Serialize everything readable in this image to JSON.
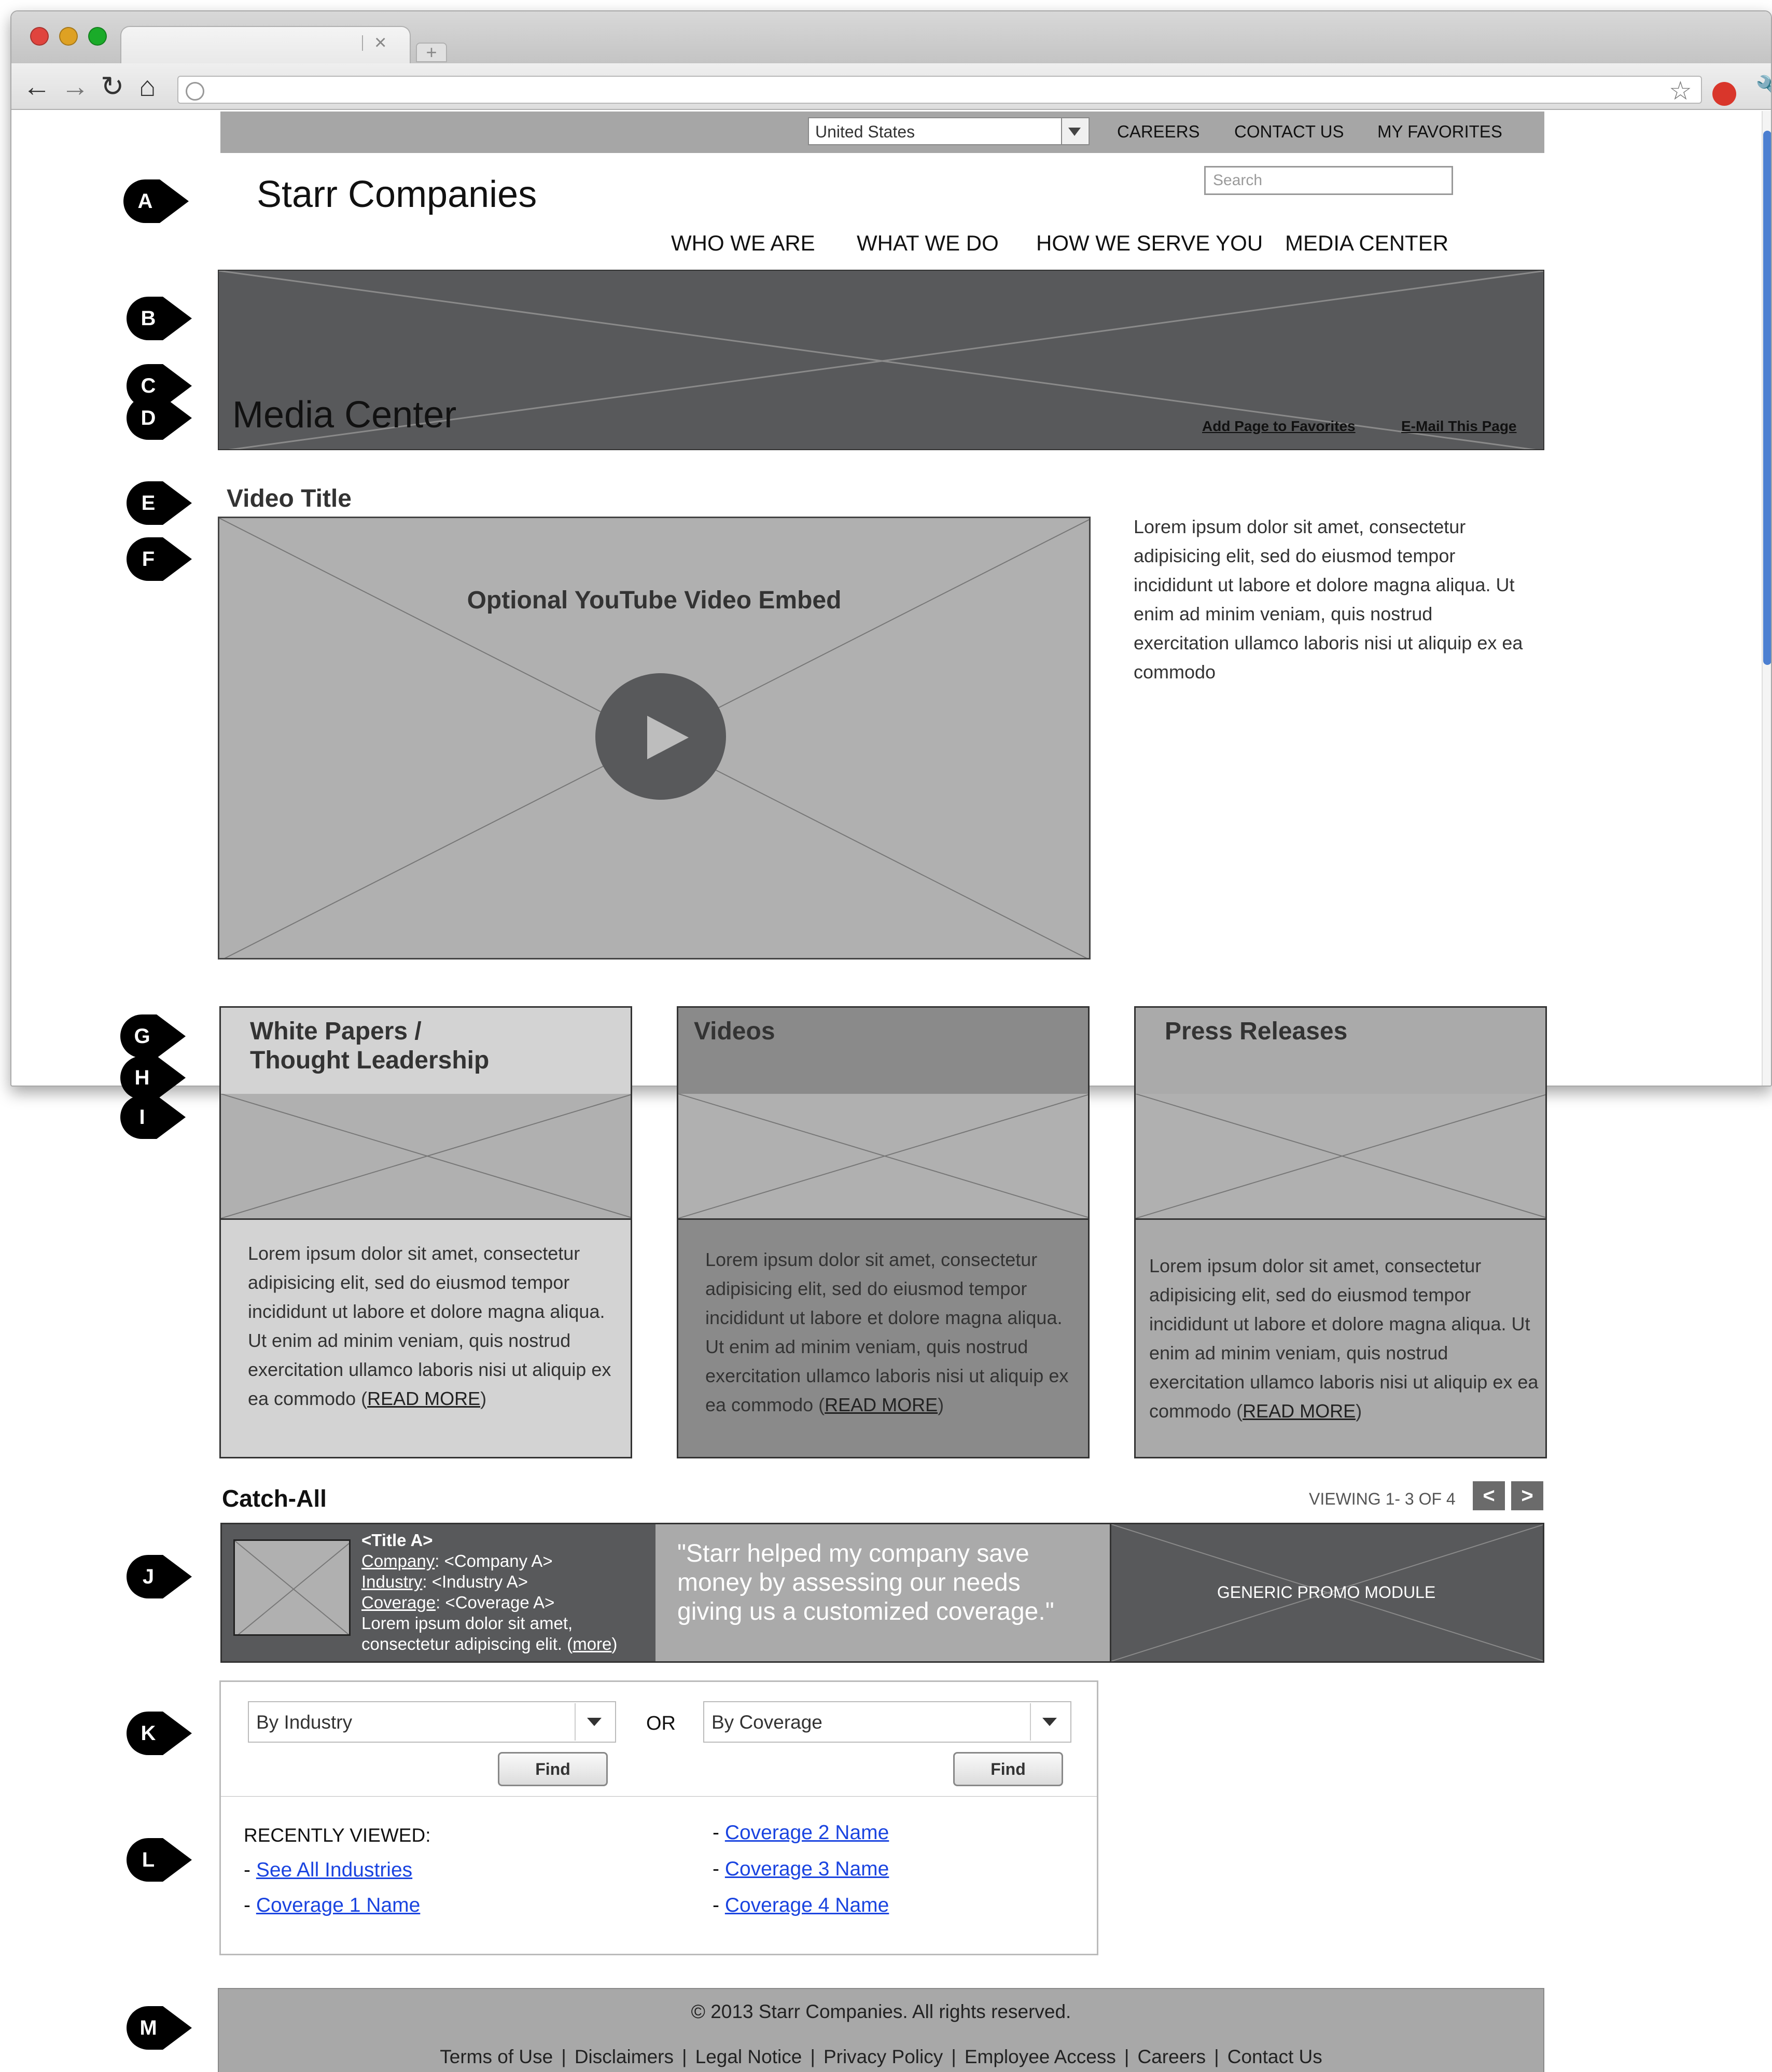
{
  "browser": {
    "tab_close": "×",
    "new_tab": "+",
    "back": "←",
    "forward": "→",
    "reload": "↻",
    "home": "⌂",
    "bookmark_star": "☆",
    "extension_icon": "extension-icon",
    "wrench": "🔧",
    "colors": {
      "close": "#e0443e",
      "minimize": "#dea123",
      "zoom": "#1aab29"
    }
  },
  "utility": {
    "country": "United States",
    "links": [
      "CAREERS",
      "CONTACT US",
      "MY FAVORITES"
    ]
  },
  "search": {
    "placeholder": "Search"
  },
  "site_title": "Starr Companies",
  "nav": [
    "WHO WE ARE",
    "WHAT WE DO",
    "HOW WE SERVE YOU",
    "MEDIA CENTER"
  ],
  "hero": {
    "title": "Media Center",
    "add_favorites": "Add Page to Favorites",
    "email_page": "E-Mail This Page"
  },
  "video": {
    "title": "Video Title",
    "embed_label": "Optional YouTube Video Embed",
    "description": "Lorem ipsum dolor sit amet, consectetur adipisicing elit, sed do eiusmod tempor incididunt ut labore et dolore magna aliqua. Ut enim ad minim veniam, quis nostrud exercitation ullamco laboris nisi ut aliquip ex ea commodo"
  },
  "cards": [
    {
      "title_line1": "White Papers /",
      "title_line2": "Thought Leadership",
      "body": "Lorem ipsum dolor sit amet, consectetur adipisicing elit, sed do eiusmod tempor incididunt ut labore et dolore magna aliqua. Ut enim ad minim veniam, quis nostrud exercitation ullamco laboris nisi ut aliquip ex ea commodo (",
      "read_more": "READ MORE",
      "close": ")"
    },
    {
      "title_line1": "Videos",
      "body": "Lorem ipsum dolor sit amet, consectetur adipisicing elit, sed do eiusmod tempor incididunt ut labore et dolore magna aliqua. Ut enim ad minim veniam, quis nostrud exercitation ullamco laboris nisi ut aliquip ex ea commodo (",
      "read_more": "READ MORE",
      "close": ")"
    },
    {
      "title_line1": "Press Releases",
      "body": "Lorem ipsum dolor sit amet, consectetur adipisicing elit, sed do eiusmod tempor incididunt ut labore et dolore magna aliqua. Ut enim ad minim veniam, quis nostrud exercitation ullamco laboris nisi ut aliquip ex ea commodo (",
      "read_more": "READ MORE",
      "close": ")"
    }
  ],
  "catch_all": {
    "title": "Catch-All",
    "viewing": "VIEWING 1- 3 OF 4",
    "prev": "<",
    "next": ">",
    "promo_a": {
      "title": "<Title A>",
      "company_label": "Company",
      "company_value": ": <Company A>",
      "industry_label": "Industry",
      "industry_value": ": <Industry A>",
      "coverage_label": "Coverage",
      "coverage_value": ": <Coverage A>",
      "text_line1": "Lorem ipsum dolor sit amet,",
      "text_line2": "consectetur adipiscing elit. (",
      "more": "more",
      "close": ")"
    },
    "quote": "\"Starr helped my company save money by assessing our needs giving us a customized coverage.\"",
    "generic_label": "GENERIC PROMO MODULE"
  },
  "finder": {
    "industry_select": "By Industry",
    "or": "OR",
    "coverage_select": "By Coverage",
    "find": "Find"
  },
  "recent": {
    "heading": "RECENTLY VIEWED:",
    "dash": "- ",
    "left_links": [
      "See All Industries",
      "Coverage 1 Name"
    ],
    "right_links": [
      "Coverage 2 Name",
      "Coverage 3 Name",
      "Coverage 4 Name"
    ]
  },
  "footer": {
    "copyright": "© 2013 Starr Companies. All rights reserved.",
    "separator": "|",
    "links": [
      "Terms of Use",
      "Disclaimers",
      "Legal Notice",
      "Privacy Policy",
      "Employee Access",
      "Careers",
      "Contact Us"
    ]
  },
  "markers": [
    "A",
    "B",
    "C",
    "D",
    "E",
    "F",
    "G",
    "H",
    "I",
    "J",
    "K",
    "L",
    "M"
  ]
}
